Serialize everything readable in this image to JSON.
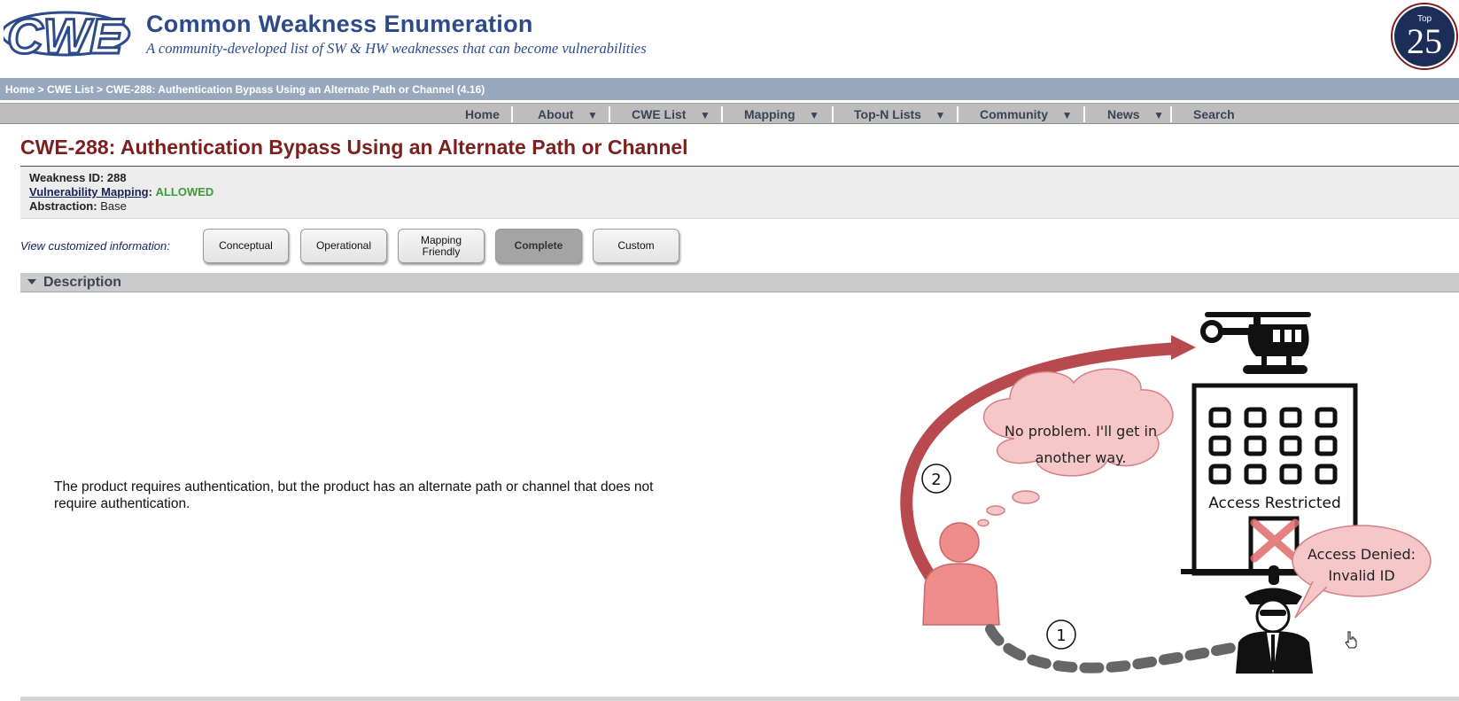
{
  "header": {
    "logo_text": "CWE",
    "title": "Common Weakness Enumeration",
    "tagline": "A community-developed list of SW & HW weaknesses that can become vulnerabilities",
    "badge_top": "Top",
    "badge_number": "25"
  },
  "breadcrumb": {
    "home": "Home",
    "sep1": " > ",
    "list": "CWE List",
    "sep2": " > ",
    "current": "CWE-288: Authentication Bypass Using an Alternate Path or Channel (4.16)"
  },
  "nav": [
    {
      "label": "Home",
      "arrow": ""
    },
    {
      "label": "About",
      "arrow": "▼"
    },
    {
      "label": "CWE List",
      "arrow": "▼"
    },
    {
      "label": "Mapping",
      "arrow": "▼"
    },
    {
      "label": "Top-N Lists",
      "arrow": "▼"
    },
    {
      "label": "Community",
      "arrow": "▼"
    },
    {
      "label": "News",
      "arrow": "▼"
    },
    {
      "label": "Search",
      "arrow": ""
    }
  ],
  "page": {
    "title": "CWE-288: Authentication Bypass Using an Alternate Path or Channel"
  },
  "meta": {
    "weakness_id_label": "Weakness ID:",
    "weakness_id": "288",
    "mapping_label": "Vulnerability Mapping",
    "mapping_value": "ALLOWED",
    "abstraction_label": "Abstraction:",
    "abstraction_value": "Base"
  },
  "views": {
    "label": "View customized information:",
    "buttons": [
      "Conceptual",
      "Operational",
      "Mapping Friendly",
      "Complete",
      "Custom"
    ],
    "active": "Complete"
  },
  "description": {
    "header": "Description",
    "text": "The product requires authentication, but the product has an alternate path or channel that does not require authentication.",
    "illustration": {
      "thought": [
        "No problem. I'll get in",
        "another way."
      ],
      "building_label": "Access Restricted",
      "guard_speech": [
        "Access Denied:",
        "Invalid ID"
      ],
      "step1": "1",
      "step2": "2"
    }
  },
  "colors": {
    "brand_blue": "#2d4a8a",
    "title_red": "#7b1f1f",
    "allowed_green": "#3c9a3c",
    "arrow_red": "#b84a4f",
    "bubble_pink": "#f6c7c9"
  }
}
